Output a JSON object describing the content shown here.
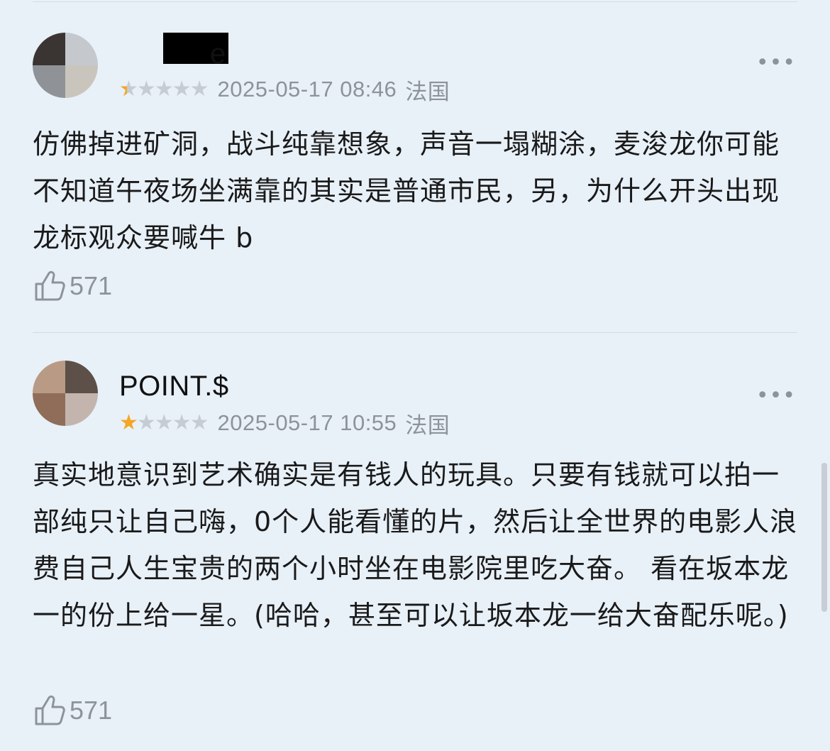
{
  "reviews": [
    {
      "username_visible": "e",
      "rating": 0.5,
      "date": "2025-05-17 08:46",
      "location": "法国",
      "more_label": "•••",
      "content": "仿佛掉进矿洞，战斗纯靠想象，声音一塌糊涂，麦浚龙你可能不知道午夜场坐满靠的其实是普通市民，另，为什么开头出现龙标观众要喊牛 b",
      "likes": "571"
    },
    {
      "username": "POINT.$",
      "rating": 1,
      "date": "2025-05-17 10:55",
      "location": "法国",
      "more_label": "•••",
      "content": "真实地意识到艺术确实是有钱人的玩具。只要有钱就可以拍一部纯只让自己嗨，0个人能看懂的片，然后让全世界的电影人浪费自己人生宝贵的两个小时坐在电影院里吃大奋。 看在坂本龙一的份上给一星。(哈哈，甚至可以让坂本龙一给大奋配乐呢。)",
      "likes": "571"
    }
  ],
  "colors": {
    "background": "#e8f0f8",
    "star_filled": "#f5a623",
    "star_empty": "#c6ccd4",
    "meta_text": "#8d9399"
  },
  "icons": {
    "like": "thumbs-up-icon",
    "more": "more-dots-icon",
    "star": "star-icon"
  }
}
